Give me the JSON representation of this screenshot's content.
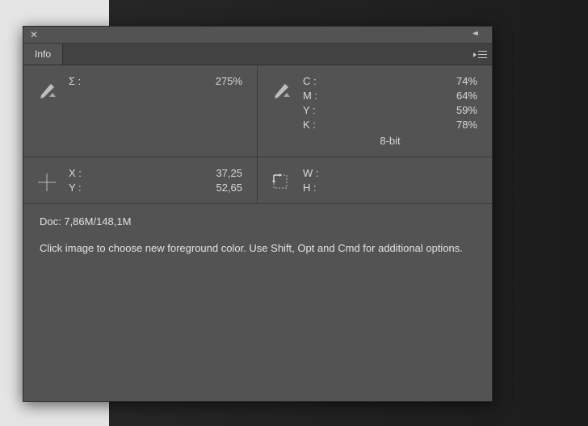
{
  "tab": {
    "label": "Info"
  },
  "ink": {
    "sigma_label": "Σ :",
    "sigma_value": "275%"
  },
  "cmyk": {
    "c_label": "C :",
    "c_value": "74%",
    "m_label": "M :",
    "m_value": "64%",
    "y_label": "Y :",
    "y_value": "59%",
    "k_label": "K :",
    "k_value": "78%",
    "bitdepth": "8-bit"
  },
  "pos": {
    "x_label": "X :",
    "x_value": "37,25",
    "y_label": "Y :",
    "y_value": "52,65"
  },
  "dim": {
    "w_label": "W :",
    "w_value": "",
    "h_label": "H :",
    "h_value": ""
  },
  "doc": "Doc: 7,86M/148,1M",
  "hint": "Click image to choose new foreground color.  Use Shift, Opt and Cmd for additional options."
}
